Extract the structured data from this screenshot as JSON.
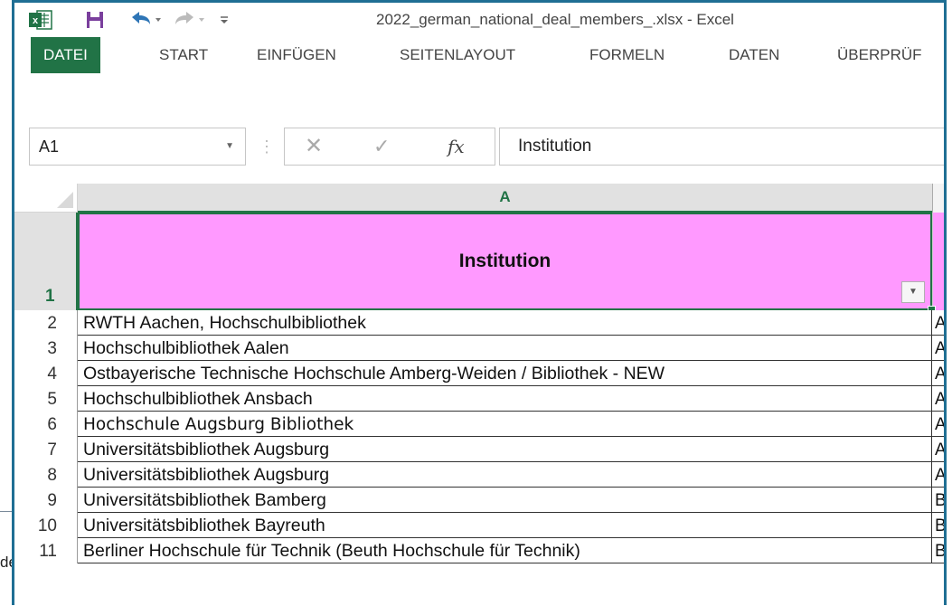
{
  "window": {
    "title": "2022_german_national_deal_members_.xlsx - Excel"
  },
  "qat": {
    "app_icon": "excel-icon",
    "save_icon": "save-icon",
    "undo_icon": "undo-icon",
    "redo_icon": "redo-icon",
    "customize_icon": "customize-qat-icon"
  },
  "ribbon": {
    "tabs": [
      {
        "label": "DATEI",
        "active": true
      },
      {
        "label": "START"
      },
      {
        "label": "EINFÜGEN"
      },
      {
        "label": "SEITENLAYOUT"
      },
      {
        "label": "FORMELN"
      },
      {
        "label": "DATEN"
      },
      {
        "label": "ÜBERPRÜF"
      }
    ]
  },
  "formula_bar": {
    "name_box": "A1",
    "dots": "⋮",
    "cancel_glyph": "✕",
    "enter_glyph": "✓",
    "fx_glyph": "fx",
    "value": "Institution"
  },
  "grid": {
    "column_headers": [
      "A"
    ],
    "header_row": {
      "row": "1",
      "value": "Institution",
      "fill_color": "#ff99ff"
    },
    "rows": [
      {
        "row": "2",
        "a": "RWTH Aachen, Hochschulbibliothek",
        "b": "A"
      },
      {
        "row": "3",
        "a": "Hochschulbibliothek Aalen",
        "b": "A"
      },
      {
        "row": "4",
        "a": "Ostbayerische Technische Hochschule Amberg-Weiden / Bibliothek - NEW",
        "b": "A"
      },
      {
        "row": "5",
        "a": "Hochschulbibliothek Ansbach",
        "b": "A"
      },
      {
        "row": "6",
        "a": "Hochschule Augsburg Bibliothek",
        "b": "A"
      },
      {
        "row": "7",
        "a": "Universitätsbibliothek Augsburg",
        "b": "A"
      },
      {
        "row": "8",
        "a": "Universitätsbibliothek Augsburg",
        "b": "A"
      },
      {
        "row": "9",
        "a": "Universitätsbibliothek Bamberg",
        "b": "B"
      },
      {
        "row": "10",
        "a": "Universitätsbibliothek Bayreuth",
        "b": "B"
      },
      {
        "row": "11",
        "a": "Berliner Hochschule für Technik (Beuth Hochschule für Technik)",
        "b": "B"
      }
    ]
  },
  "background_window": {
    "text": "de"
  },
  "colors": {
    "excel_green": "#217346",
    "header_fill": "#ff99ff"
  }
}
